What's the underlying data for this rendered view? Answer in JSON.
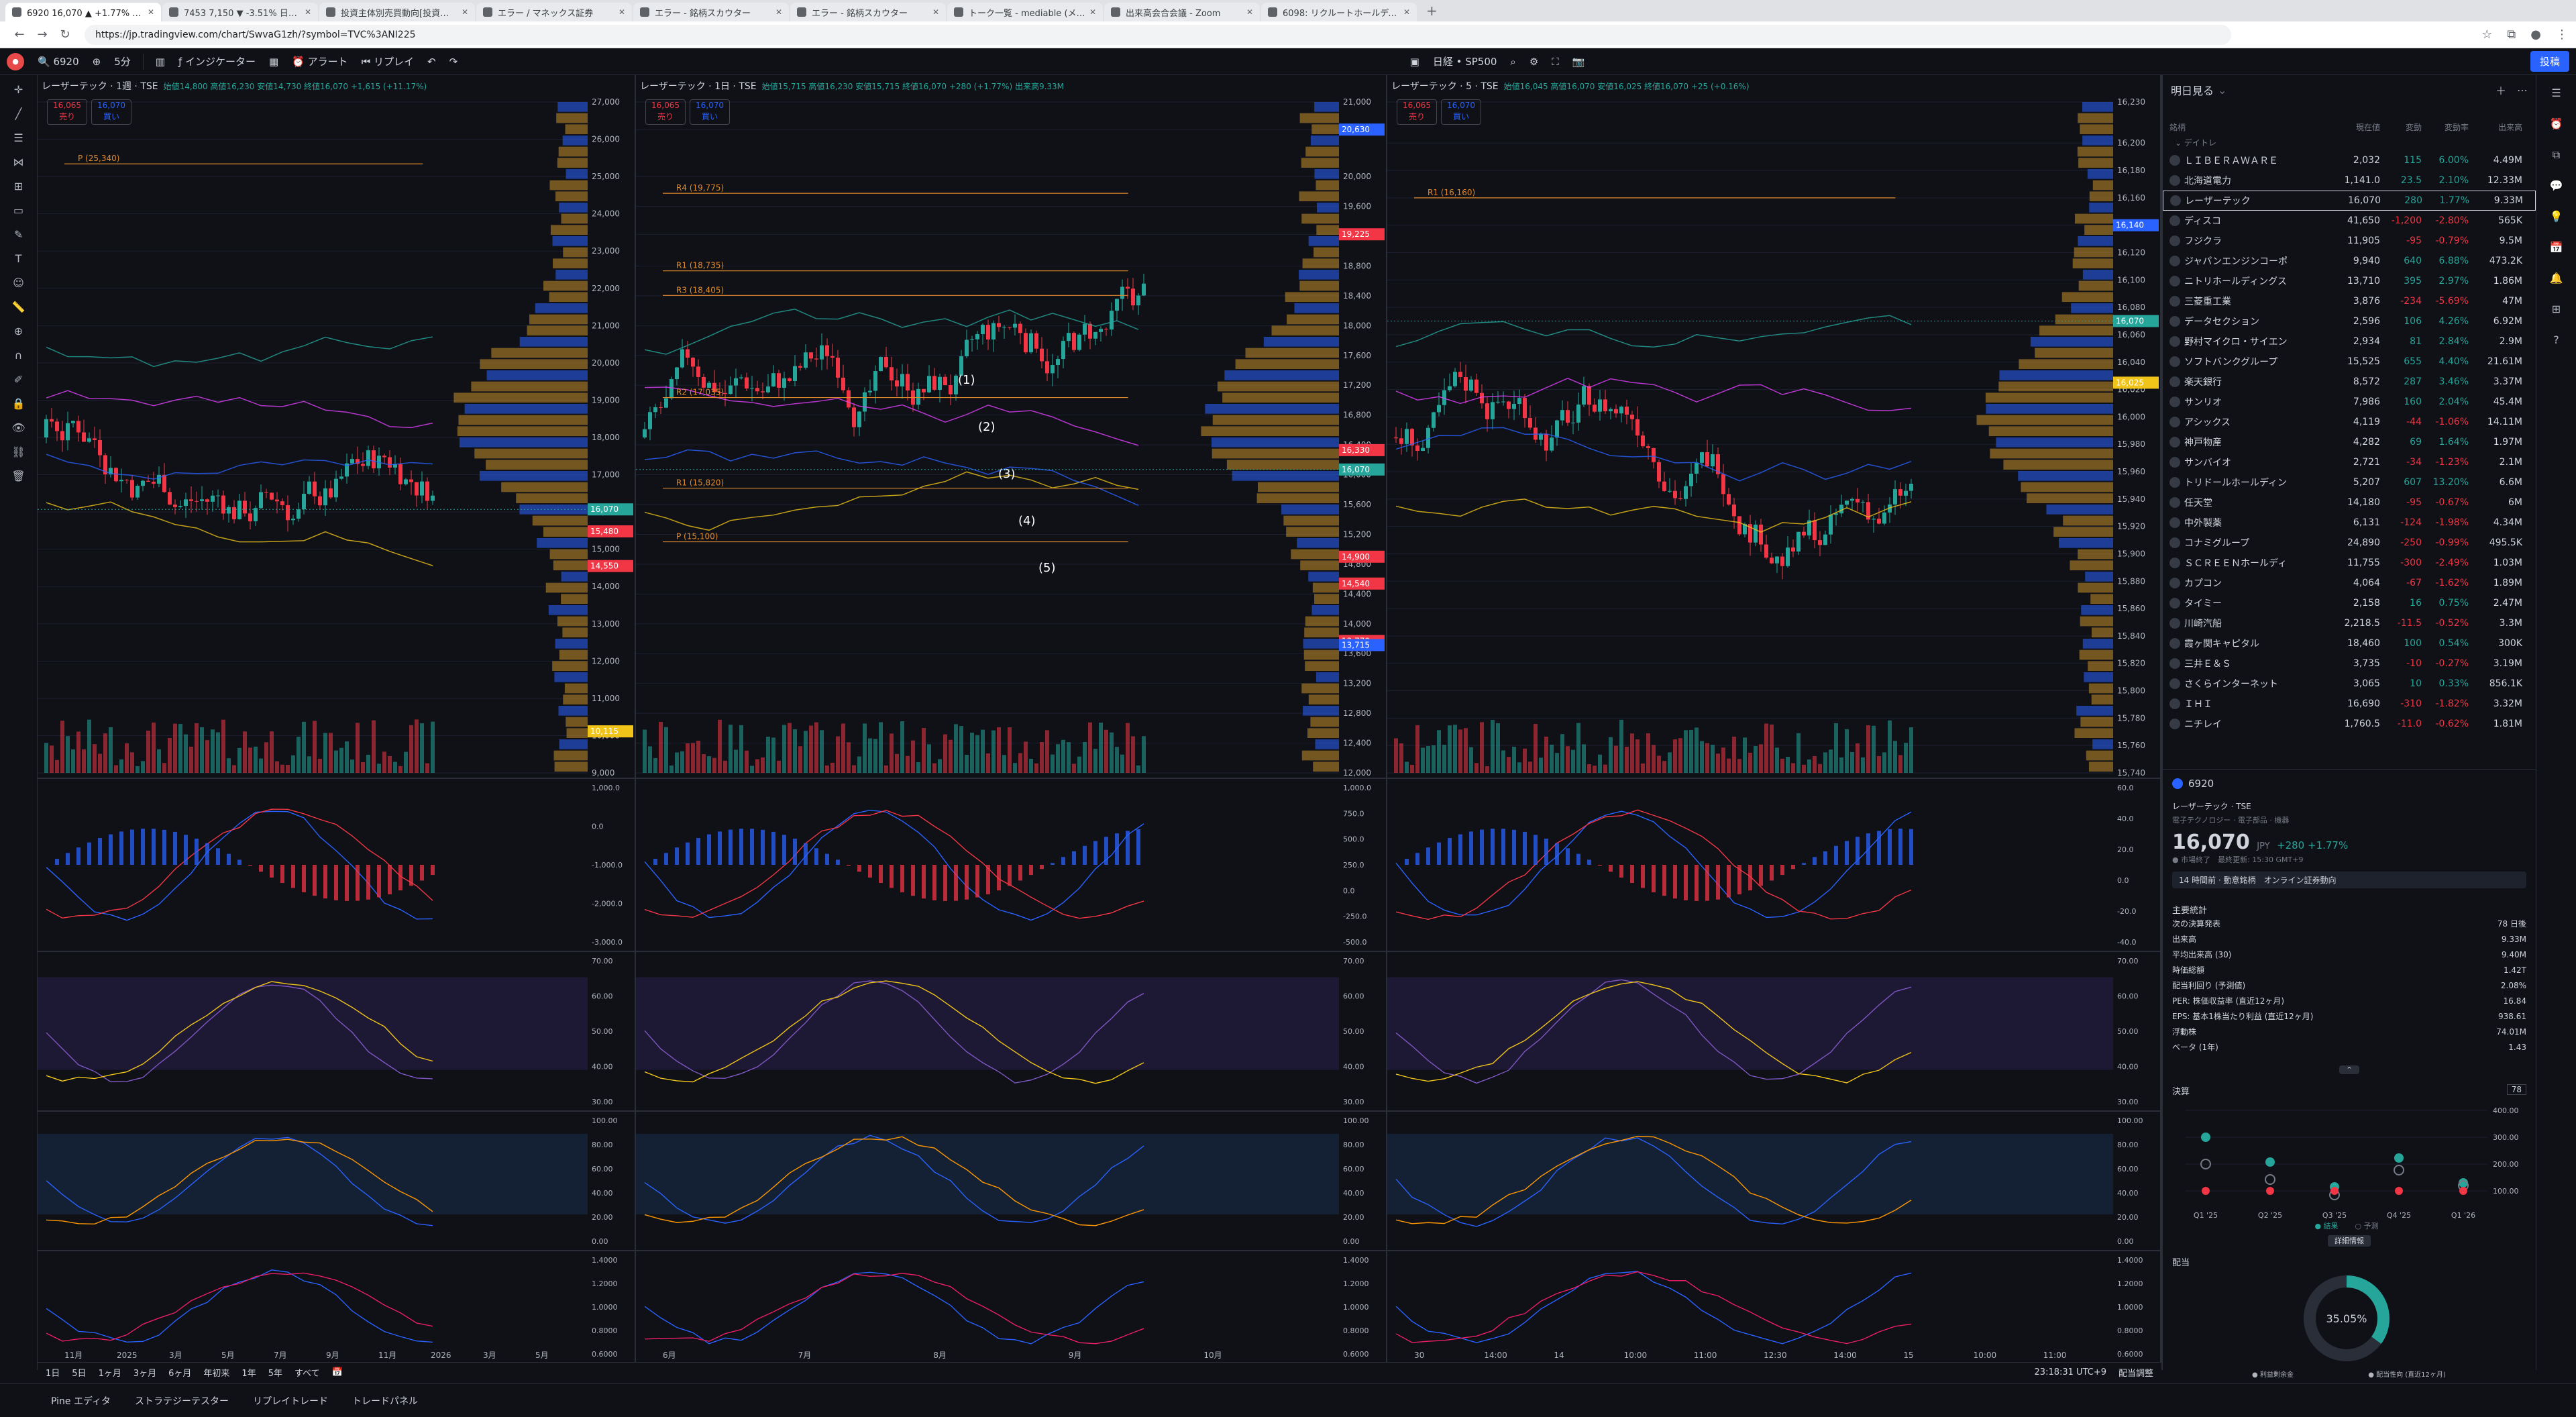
{
  "browser": {
    "tabs": [
      {
        "title": "6920 16,070 ▲ +1.77% 日経·SP5...",
        "active": true
      },
      {
        "title": "7453 7,150 ▼ -3.51% 日経·SP5...",
        "active": false
      },
      {
        "title": "投資主体別売買動向[投資部門別...",
        "active": false
      },
      {
        "title": "エラー / マネックス証券",
        "active": false
      },
      {
        "title": "エラー - 銘柄スカウター",
        "active": false
      },
      {
        "title": "エラー - 銘柄スカウター",
        "active": false
      },
      {
        "title": "トーク一覧 - mediable (メディアブル)",
        "active": false
      },
      {
        "title": "出来高会合会議 - Zoom",
        "active": false
      },
      {
        "title": "6098: リクルートホールディングス | 大...",
        "active": false
      }
    ],
    "url": "https://jp.tradingview.com/chart/SwvaG1zh/?symbol=TVC%3ANI225"
  },
  "toolbar": {
    "symbol": "6920",
    "interval": "5分",
    "indicators": "インジケーター",
    "alert": "アラート",
    "replay": "リプレイ",
    "index_label": "日経 • SP500",
    "publish": "投稿"
  },
  "panes": [
    {
      "title": "レーザーテック · 1週 · TSE",
      "ohlc": "始値14,800 高値16,230 安値14,730 終値16,070 +1,615 (+11.17%)",
      "sell": {
        "price": "16,065",
        "label": "売り"
      },
      "buy": {
        "price": "16,070",
        "label": "買い"
      },
      "indicator_count": "11",
      "price_axis": [
        "27,000",
        "26,000",
        "25,000",
        "24,000",
        "23,000",
        "22,000",
        "21,000",
        "20,000",
        "19,000",
        "18,000",
        "17,000",
        "16,000",
        "15,000",
        "14,000",
        "13,000",
        "12,000",
        "11,000",
        "10,000",
        "9,000"
      ],
      "axis_min": 9000,
      "axis_max": 27000,
      "last_price": 16070,
      "time_axis": [
        "11月",
        "2025",
        "3月",
        "5月",
        "7月",
        "9月",
        "11月",
        "2026",
        "3月",
        "5月"
      ],
      "labels": [
        {
          "text": "P (25,340)",
          "value": 25340
        }
      ],
      "tags": [
        {
          "text": "16,070",
          "value": 16070,
          "color": "#26a69a"
        },
        {
          "text": "15,480",
          "value": 15480,
          "color": "#f23645"
        },
        {
          "text": "14,550",
          "value": 14550,
          "color": "#f23645"
        },
        {
          "text": "10,115",
          "value": 10115,
          "color": "#f0c419"
        }
      ],
      "macd_axis": [
        "1,000.0",
        "0.0",
        "-1,000.0",
        "-2,000.0",
        "-3,000.0"
      ],
      "rsi_axis": [
        "70.00",
        "60.00",
        "50.00",
        "40.00",
        "30.00"
      ]
    },
    {
      "title": "レーザーテック · 1日 · TSE",
      "ohlc": "始値15,715 高値16,230 安値15,715 終値16,070 +280 (+1.77%) 出来高9.33M",
      "sell": {
        "price": "16,065",
        "label": "売り"
      },
      "buy": {
        "price": "16,070",
        "label": "買い"
      },
      "indicator_count": "12",
      "price_axis": [
        "21,000",
        "20,630",
        "20,000",
        "19,600",
        "19,225",
        "18,800",
        "18,400",
        "18,000",
        "17,600",
        "17,200",
        "16,800",
        "16,400",
        "16,000",
        "15,600",
        "15,200",
        "14,800",
        "14,400",
        "14,000",
        "13,600",
        "13,200",
        "12,800",
        "12,400",
        "12,000"
      ],
      "axis_min": 12000,
      "axis_max": 21000,
      "last_price": 16070,
      "time_axis": [
        "6月",
        "7月",
        "8月",
        "9月",
        "10月"
      ],
      "labels": [
        {
          "text": "R4 (19,775)",
          "value": 19775
        },
        {
          "text": "R3 (18,405)",
          "value": 18405
        },
        {
          "text": "R1 (18,735)",
          "value": 18735
        },
        {
          "text": "R2 (17,035)",
          "value": 17035
        },
        {
          "text": "R1 (15,820)",
          "value": 15820
        },
        {
          "text": "P (15,100)",
          "value": 15100
        }
      ],
      "waves": [
        "(1)",
        "(2)",
        "(3)",
        "(4)",
        "(5)"
      ],
      "tags": [
        {
          "text": "20,630",
          "value": 20630,
          "color": "#2962ff"
        },
        {
          "text": "19,225",
          "value": 19225,
          "color": "#f23645"
        },
        {
          "text": "16,070",
          "value": 16070,
          "color": "#26a69a"
        },
        {
          "text": "16,330",
          "value": 16330,
          "color": "#f23645"
        },
        {
          "text": "14,900",
          "value": 14900,
          "color": "#f23645"
        },
        {
          "text": "14,540",
          "value": 14540,
          "color": "#f23645"
        },
        {
          "text": "13,770",
          "value": 13770,
          "color": "#f23645"
        },
        {
          "text": "13,715",
          "value": 13715,
          "color": "#2962ff"
        }
      ],
      "macd_axis": [
        "1,000.0",
        "750.0",
        "500.0",
        "250.0",
        "0.0",
        "-250.0",
        "-500.0"
      ],
      "rsi_axis": [
        "70.00",
        "60.00",
        "50.00",
        "40.00",
        "30.00"
      ]
    },
    {
      "title": "レーザーテック · 5 · TSE",
      "ohlc": "始値16,045 高値16,070 安値16,025 終値16,070 +25 (+0.16%)",
      "sell": {
        "price": "16,065",
        "label": "売り"
      },
      "buy": {
        "price": "16,070",
        "label": "買い"
      },
      "indicator_count": "11",
      "price_axis": [
        "16,230",
        "16,200",
        "16,180",
        "16,160",
        "16,140",
        "16,120",
        "16,100",
        "16,080",
        "16,060",
        "16,040",
        "16,020",
        "16,000",
        "15,980",
        "15,960",
        "15,940",
        "15,920",
        "15,900",
        "15,880",
        "15,860",
        "15,840",
        "15,820",
        "15,800",
        "15,780",
        "15,760",
        "15,740"
      ],
      "axis_min": 15740,
      "axis_max": 16230,
      "last_price": 16070,
      "time_axis": [
        "30",
        "14:00",
        "14",
        "10:00",
        "11:00",
        "12:30",
        "14:00",
        "15",
        "10:00",
        "11:00"
      ],
      "labels": [
        {
          "text": "R1 (16,160)",
          "value": 16160
        }
      ],
      "tags": [
        {
          "text": "16,140",
          "value": 16140,
          "color": "#2962ff"
        },
        {
          "text": "16,070",
          "value": 16070,
          "color": "#26a69a"
        },
        {
          "text": "16,025",
          "value": 16025,
          "color": "#f0c419"
        }
      ],
      "macd_axis": [
        "60.0",
        "40.0",
        "20.0",
        "0.0",
        "-20.0",
        "-40.0"
      ],
      "rsi_axis": [
        "70.00",
        "60.00",
        "50.00",
        "40.00",
        "30.00"
      ]
    }
  ],
  "stoch_axis": [
    "100.00",
    "80.00",
    "60.00",
    "40.00",
    "20.00",
    "0.00"
  ],
  "ratio_axis": [
    "1.4000",
    "1.2000",
    "1.0000",
    "0.8000",
    "0.6000"
  ],
  "timebar": {
    "ranges": [
      "1日",
      "5日",
      "1ヶ月",
      "3ヶ月",
      "6ヶ月",
      "年初来",
      "1年",
      "5年",
      "すべて"
    ],
    "time": "23:18:31 UTC+9",
    "adjust": "配当調整"
  },
  "bottom_tabs": [
    "Pine エディタ",
    "ストラテジーテスター",
    "リプレイトレード",
    "トレードパネル"
  ],
  "watchlist": {
    "title": "明日見る",
    "columns": [
      "銘柄",
      "現在値",
      "変動",
      "変動率",
      "出来高"
    ],
    "section": "デイトレ",
    "rows": [
      {
        "name": "ＬＩＢＥＲＡＷＡＲＥ",
        "price": "2,032",
        "chg": "115",
        "pct": "6.00%",
        "vol": "4.49M",
        "dir": "up"
      },
      {
        "name": "北海道電力",
        "price": "1,141.0",
        "chg": "23.5",
        "pct": "2.10%",
        "vol": "12.33M",
        "dir": "up"
      },
      {
        "name": "レーザーテック",
        "price": "16,070",
        "chg": "280",
        "pct": "1.77%",
        "vol": "9.33M",
        "dir": "up",
        "selected": true
      },
      {
        "name": "ディスコ",
        "price": "41,650",
        "chg": "-1,200",
        "pct": "-2.80%",
        "vol": "565K",
        "dir": "dn"
      },
      {
        "name": "フジクラ",
        "price": "11,905",
        "chg": "-95",
        "pct": "-0.79%",
        "vol": "9.5M",
        "dir": "dn"
      },
      {
        "name": "ジャパンエンジンコーポ",
        "price": "9,940",
        "chg": "640",
        "pct": "6.88%",
        "vol": "473.2K",
        "dir": "up"
      },
      {
        "name": "ニトリホールディングス",
        "price": "13,710",
        "chg": "395",
        "pct": "2.97%",
        "vol": "1.86M",
        "dir": "up"
      },
      {
        "name": "三菱重工業",
        "price": "3,876",
        "chg": "-234",
        "pct": "-5.69%",
        "vol": "47M",
        "dir": "dn"
      },
      {
        "name": "データセクション",
        "price": "2,596",
        "chg": "106",
        "pct": "4.26%",
        "vol": "6.92M",
        "dir": "up"
      },
      {
        "name": "野村マイクロ・サイエン",
        "price": "2,934",
        "chg": "81",
        "pct": "2.84%",
        "vol": "2.9M",
        "dir": "up"
      },
      {
        "name": "ソフトバンクグループ",
        "price": "15,525",
        "chg": "655",
        "pct": "4.40%",
        "vol": "21.61M",
        "dir": "up"
      },
      {
        "name": "楽天銀行",
        "price": "8,572",
        "chg": "287",
        "pct": "3.46%",
        "vol": "3.37M",
        "dir": "up"
      },
      {
        "name": "サンリオ",
        "price": "7,986",
        "chg": "160",
        "pct": "2.04%",
        "vol": "45.4M",
        "dir": "up"
      },
      {
        "name": "アシックス",
        "price": "4,119",
        "chg": "-44",
        "pct": "-1.06%",
        "vol": "14.11M",
        "dir": "dn"
      },
      {
        "name": "神戸物産",
        "price": "4,282",
        "chg": "69",
        "pct": "1.64%",
        "vol": "1.97M",
        "dir": "up"
      },
      {
        "name": "サンバイオ",
        "price": "2,721",
        "chg": "-34",
        "pct": "-1.23%",
        "vol": "2.1M",
        "dir": "dn"
      },
      {
        "name": "トリドールホールディン",
        "price": "5,207",
        "chg": "607",
        "pct": "13.20%",
        "vol": "6.6M",
        "dir": "up"
      },
      {
        "name": "任天堂",
        "price": "14,180",
        "chg": "-95",
        "pct": "-0.67%",
        "vol": "6M",
        "dir": "dn"
      },
      {
        "name": "中外製薬",
        "price": "6,131",
        "chg": "-124",
        "pct": "-1.98%",
        "vol": "4.34M",
        "dir": "dn"
      },
      {
        "name": "コナミグループ",
        "price": "24,890",
        "chg": "-250",
        "pct": "-0.99%",
        "vol": "495.5K",
        "dir": "dn"
      },
      {
        "name": "ＳＣＲＥＥＮホールディ",
        "price": "11,755",
        "chg": "-300",
        "pct": "-2.49%",
        "vol": "1.03M",
        "dir": "dn"
      },
      {
        "name": "カプコン",
        "price": "4,064",
        "chg": "-67",
        "pct": "-1.62%",
        "vol": "1.89M",
        "dir": "dn"
      },
      {
        "name": "タイミー",
        "price": "2,158",
        "chg": "16",
        "pct": "0.75%",
        "vol": "2.47M",
        "dir": "up"
      },
      {
        "name": "川崎汽船",
        "price": "2,218.5",
        "chg": "-11.5",
        "pct": "-0.52%",
        "vol": "3.3M",
        "dir": "dn"
      },
      {
        "name": "霞ヶ関キャピタル",
        "price": "18,460",
        "chg": "100",
        "pct": "0.54%",
        "vol": "300K",
        "dir": "up"
      },
      {
        "name": "三井Ｅ＆Ｓ",
        "price": "3,735",
        "chg": "-10",
        "pct": "-0.27%",
        "vol": "3.19M",
        "dir": "dn"
      },
      {
        "name": "さくらインターネット",
        "price": "3,065",
        "chg": "10",
        "pct": "0.33%",
        "vol": "856.1K",
        "dir": "up"
      },
      {
        "name": "ＩＨＩ",
        "price": "16,690",
        "chg": "-310",
        "pct": "-1.82%",
        "vol": "3.32M",
        "dir": "dn"
      },
      {
        "name": "ニチレイ",
        "price": "1,760.5",
        "chg": "-11.0",
        "pct": "-0.62%",
        "vol": "1.81M",
        "dir": "dn"
      }
    ]
  },
  "details": {
    "symbol": "6920",
    "name": "レーザーテック · TSE",
    "sector": "電子テクノロジー · 電子部品 · 機器",
    "price": "16,070",
    "currency": "JPY",
    "change": "+280 +1.77%",
    "status": "● 市場終了　最終更新: 15:30 GMT+9",
    "news": "14 時間前 · 動意銘柄　オンライン証券動向",
    "stats_title": "主要統計",
    "stats": [
      {
        "k": "次の決算発表",
        "v": "78 日後"
      },
      {
        "k": "出来高",
        "v": "9.33M"
      },
      {
        "k": "平均出来高 (30)",
        "v": "9.40M"
      },
      {
        "k": "時価総額",
        "v": "1.42T"
      },
      {
        "k": "配当利回り (予測値)",
        "v": "2.08%"
      },
      {
        "k": "PER: 株価収益率 (直近12ヶ月)",
        "v": "16.84"
      },
      {
        "k": "EPS: 基本1株当たり利益 (直近12ヶ月)",
        "v": "938.61"
      },
      {
        "k": "浮動株",
        "v": "74.01M"
      },
      {
        "k": "ベータ (1年)",
        "v": "1.43"
      }
    ],
    "earnings_title": "決算",
    "earnings_badge": "78",
    "earnings_axis": [
      "400.00",
      "300.00",
      "200.00",
      "100.00"
    ],
    "earnings_quarters": [
      "Q1 '25",
      "Q2 '25",
      "Q3 '25",
      "Q4 '25",
      "Q1 '26"
    ],
    "earnings_legend": [
      "● 結果",
      "○ 予測"
    ],
    "detail_button": "詳細情報",
    "dividend_title": "配当",
    "dividend_pct": "35.05%",
    "dividend_legend": [
      "● 利益剰余金",
      "● 配当性向 (直近12ヶ月)"
    ]
  }
}
